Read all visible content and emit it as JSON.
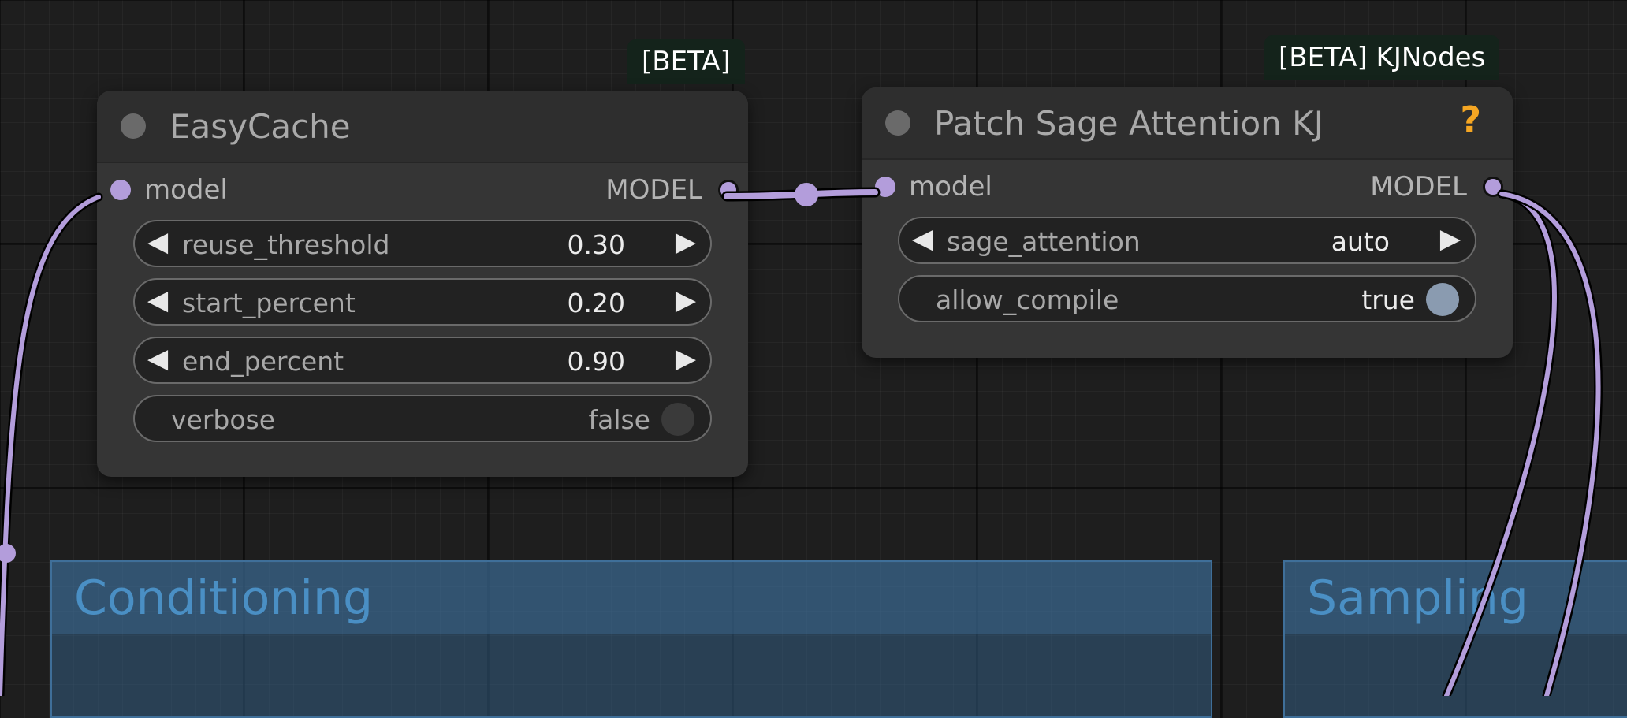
{
  "groups": [
    {
      "title": "Conditioning"
    },
    {
      "title": "Sampling"
    }
  ],
  "nodes": {
    "easycache": {
      "badge": "[BETA]",
      "title": "EasyCache",
      "input_label": "model",
      "output_label": "MODEL",
      "widgets": [
        {
          "name": "reuse_threshold",
          "value": "0.30"
        },
        {
          "name": "start_percent",
          "value": "0.20"
        },
        {
          "name": "end_percent",
          "value": "0.90"
        }
      ],
      "toggle": {
        "name": "verbose",
        "value": "false"
      }
    },
    "patch_sage": {
      "badge": "[BETA] KJNodes",
      "title": "Patch Sage Attention KJ",
      "help_icon": "?",
      "input_label": "model",
      "output_label": "MODEL",
      "widgets": [
        {
          "name": "sage_attention",
          "value": "auto"
        }
      ],
      "toggle": {
        "name": "allow_compile",
        "value": "true"
      }
    }
  },
  "icons": {
    "left_arrow": "◀",
    "right_arrow": "▶",
    "node_dot": "node-status-dot",
    "toggle_off": "toggle-off-knob",
    "toggle_on": "toggle-on-knob"
  },
  "colors": {
    "canvas_bg": "#1e1e1e",
    "node_bg": "#353535",
    "node_header": "#2e2e2e",
    "model_link": "#b39ddb",
    "group_bg": "#335d82",
    "group_title": "#4a8fc4",
    "help_icon": "#f5a623",
    "toggle_on": "#8a9bb0",
    "toggle_off": "#3a3a3a"
  }
}
